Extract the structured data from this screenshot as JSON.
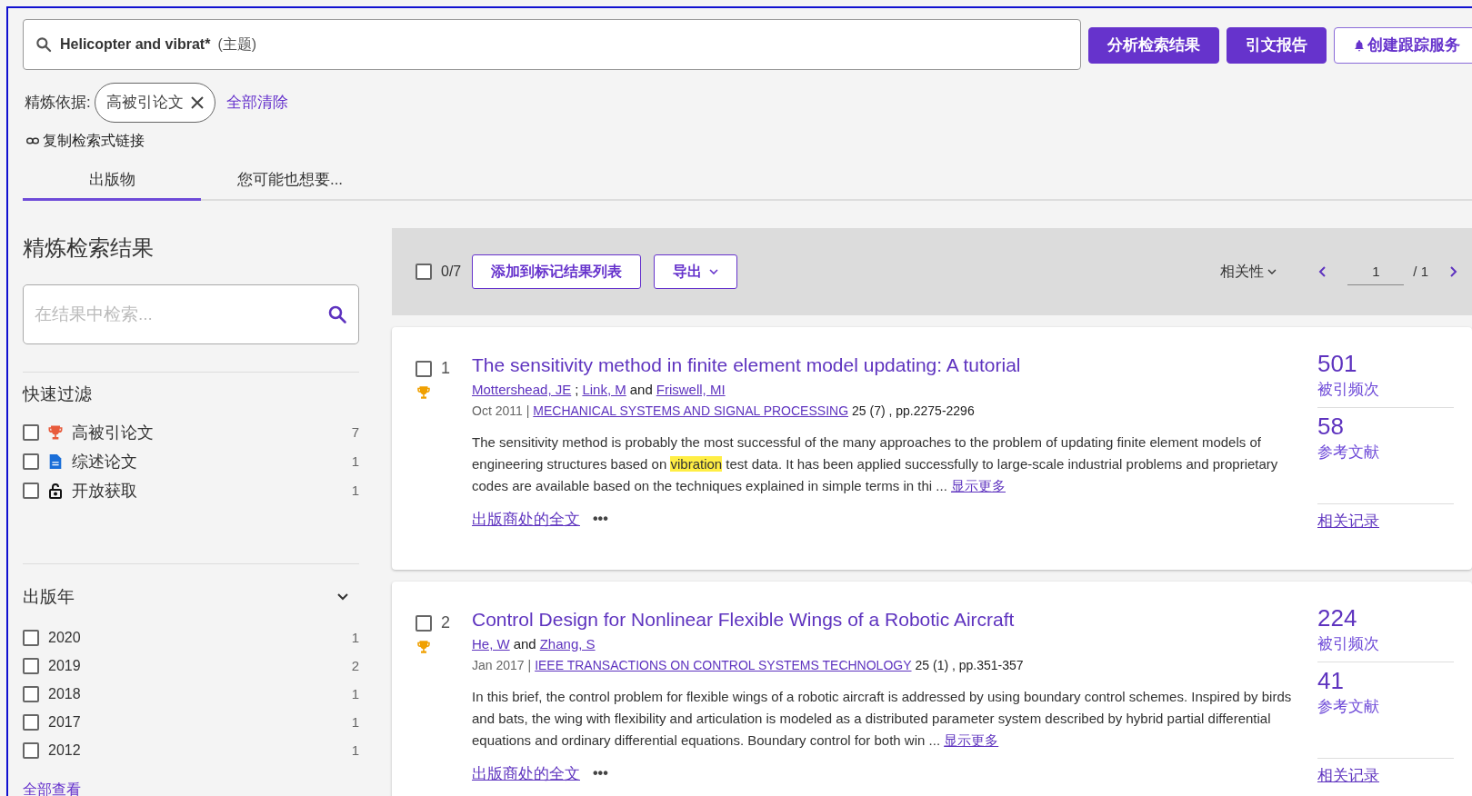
{
  "search": {
    "query": "Helicopter and vibrat*",
    "field": "(主题)"
  },
  "header_buttons": [
    {
      "label": "分析检索结果",
      "kind": "primary"
    },
    {
      "label": "引文报告",
      "kind": "primary"
    },
    {
      "label": "创建跟踪服务",
      "kind": "outline"
    }
  ],
  "refine": {
    "label": "精炼依据:",
    "chips": [
      "高被引论文"
    ],
    "clear": "全部清除"
  },
  "copy_link": "复制检索式链接",
  "tabs": [
    {
      "label": "出版物",
      "selected": true
    },
    {
      "label": "您可能也想要...",
      "selected": false
    }
  ],
  "sidebar": {
    "title": "精炼检索结果",
    "search_placeholder": "在结果中检索...",
    "quick_filter": {
      "title": "快速过滤",
      "items": [
        {
          "label": "高被引论文",
          "count": "7",
          "kind": "trophy",
          "checked": false
        },
        {
          "label": "综述论文",
          "count": "1",
          "kind": "document",
          "checked": false
        },
        {
          "label": "开放获取",
          "count": "1",
          "kind": "lock",
          "checked": false
        }
      ]
    },
    "years": {
      "title": "出版年",
      "expanded": true,
      "items": [
        {
          "label": "2020",
          "count": "1",
          "checked": false
        },
        {
          "label": "2019",
          "count": "2",
          "checked": false
        },
        {
          "label": "2018",
          "count": "1",
          "checked": false
        },
        {
          "label": "2017",
          "count": "1",
          "checked": false
        },
        {
          "label": "2012",
          "count": "1",
          "checked": false
        }
      ],
      "view_all": "全部查看"
    }
  },
  "toolbar": {
    "select_all_checked": false,
    "selected_count": "0/7",
    "add_button": "添加到标记结果列表",
    "export_button": "导出",
    "sort": "相关性",
    "page": "1",
    "pages": "/ 1"
  },
  "results": [
    {
      "checked": false,
      "number": "1",
      "highly_cited": true,
      "title": "The sensitivity method in finite element model updating: A tutorial",
      "authors": [
        {
          "text": "Mottershead, JE",
          "kind": "link"
        },
        {
          "text": ";",
          "kind": "plain"
        },
        {
          "text": "Link, M",
          "kind": "link"
        },
        {
          "text": "and",
          "kind": "plain"
        },
        {
          "text": "Friswell, MI",
          "kind": "link"
        }
      ],
      "date": "Oct 2011 |",
      "journal": "MECHANICAL SYSTEMS AND SIGNAL PROCESSING",
      "volume": "25 (7) , pp.2275-2296",
      "abstract": [
        {
          "text": "The sensitivity method is probably the most successful of the many approaches to the problem of updating finite element models of engineering structures based on ",
          "highlighted": false
        },
        {
          "text": "vibration",
          "highlighted": true
        },
        {
          "text": " test data. It has been applied successfully to large-scale industrial problems and proprietary codes are available based on the techniques explained in simple terms in thi ...",
          "highlighted": false
        }
      ],
      "show_more": "显示更多",
      "full_text": "出版商处的全文",
      "more": "•••",
      "times_cited": "501",
      "times_cited_label": "被引频次",
      "references": "58",
      "references_label": "参考文献",
      "related": "相关记录"
    },
    {
      "checked": false,
      "number": "2",
      "highly_cited": true,
      "title": "Control Design for Nonlinear Flexible Wings of a Robotic Aircraft",
      "authors": [
        {
          "text": "He, W",
          "kind": "link"
        },
        {
          "text": "and",
          "kind": "plain"
        },
        {
          "text": "Zhang, S",
          "kind": "link"
        }
      ],
      "date": "Jan 2017 |",
      "journal": "IEEE TRANSACTIONS ON CONTROL SYSTEMS TECHNOLOGY",
      "volume": "25 (1) , pp.351-357",
      "abstract": [
        {
          "text": "In this brief, the control problem for flexible wings of a robotic aircraft is addressed by using boundary control schemes. Inspired by birds and bats, the wing with flexibility and articulation is modeled as a distributed parameter system described by hybrid partial differential equations and ordinary differential equations. Boundary control for both win ...",
          "highlighted": false
        }
      ],
      "show_more": "显示更多",
      "full_text": "出版商处的全文",
      "more": "•••",
      "times_cited": "224",
      "times_cited_label": "被引频次",
      "references": "41",
      "references_label": "参考文献",
      "related": "相关记录"
    }
  ]
}
